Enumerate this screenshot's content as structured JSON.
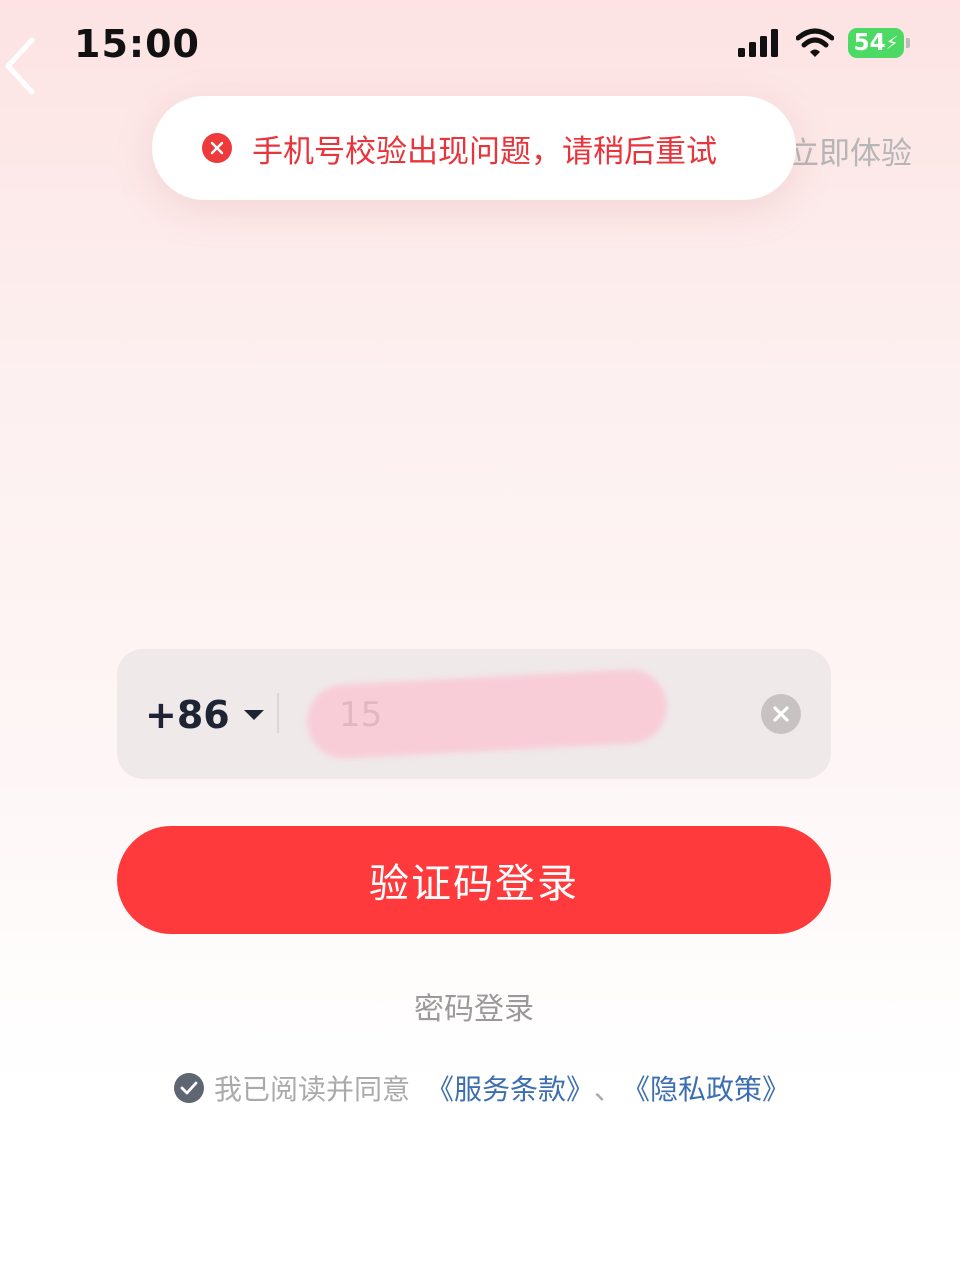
{
  "status_bar": {
    "time": "15:00",
    "battery": "54"
  },
  "header": {
    "try_link": "立即体验"
  },
  "toast": {
    "message": "手机号校验出现问题，请稍后重试",
    "color": "#e8343a"
  },
  "phone": {
    "country_code": "+86",
    "value": "15"
  },
  "login_button": {
    "label": "验证码登录",
    "color": "#fe3a3c"
  },
  "password_login": {
    "label": "密码登录"
  },
  "agreement": {
    "text": "我已阅读并同意",
    "terms": "《服务条款》",
    "separator": "、",
    "privacy": "《隐私政策》",
    "checked": true
  }
}
